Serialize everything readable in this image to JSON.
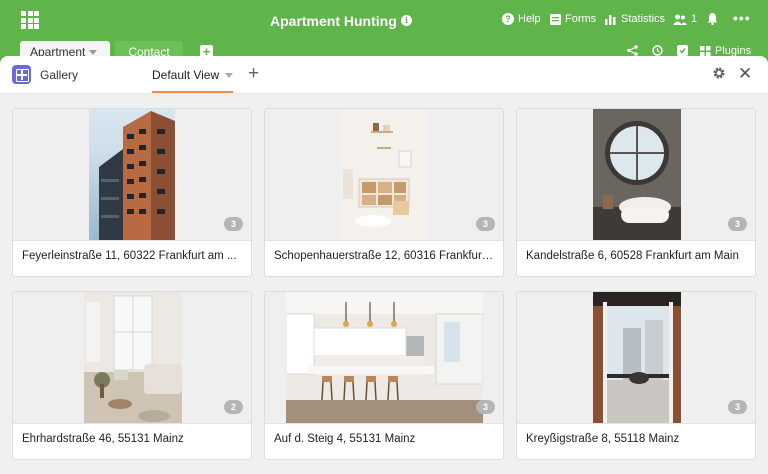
{
  "app": {
    "title": "Apartment Hunting",
    "nav": {
      "help": "Help",
      "forms": "Forms",
      "statistics": "Statistics",
      "collaborators": "1",
      "plugins": "Plugins"
    }
  },
  "tables": {
    "tabs": [
      {
        "label": "Apartment",
        "active": true
      },
      {
        "label": "Contact",
        "active": false
      }
    ]
  },
  "toolbar": {
    "view_type": "Gallery",
    "view_name": "Default View"
  },
  "cards": [
    {
      "title": "Feyerleinstraße 11, 60322 Frankfurt am ...",
      "image_count": "3"
    },
    {
      "title": "Schopenhauerstraße 12, 60316 Frankfurt ...",
      "image_count": "3"
    },
    {
      "title": "Kandelstraße 6, 60528 Frankfurt am Main",
      "image_count": "3"
    },
    {
      "title": "Ehrhardstraße 46, 55131 Mainz",
      "image_count": "2"
    },
    {
      "title": "Auf d. Steig 4, 55131 Mainz",
      "image_count": "3"
    },
    {
      "title": "Kreyßigstraße 8, 55118 Mainz",
      "image_count": "3"
    }
  ],
  "colors": {
    "brand_green": "#5fb44a",
    "accent_orange": "#f28b4b",
    "gallery_purple": "#6b6bd6"
  }
}
